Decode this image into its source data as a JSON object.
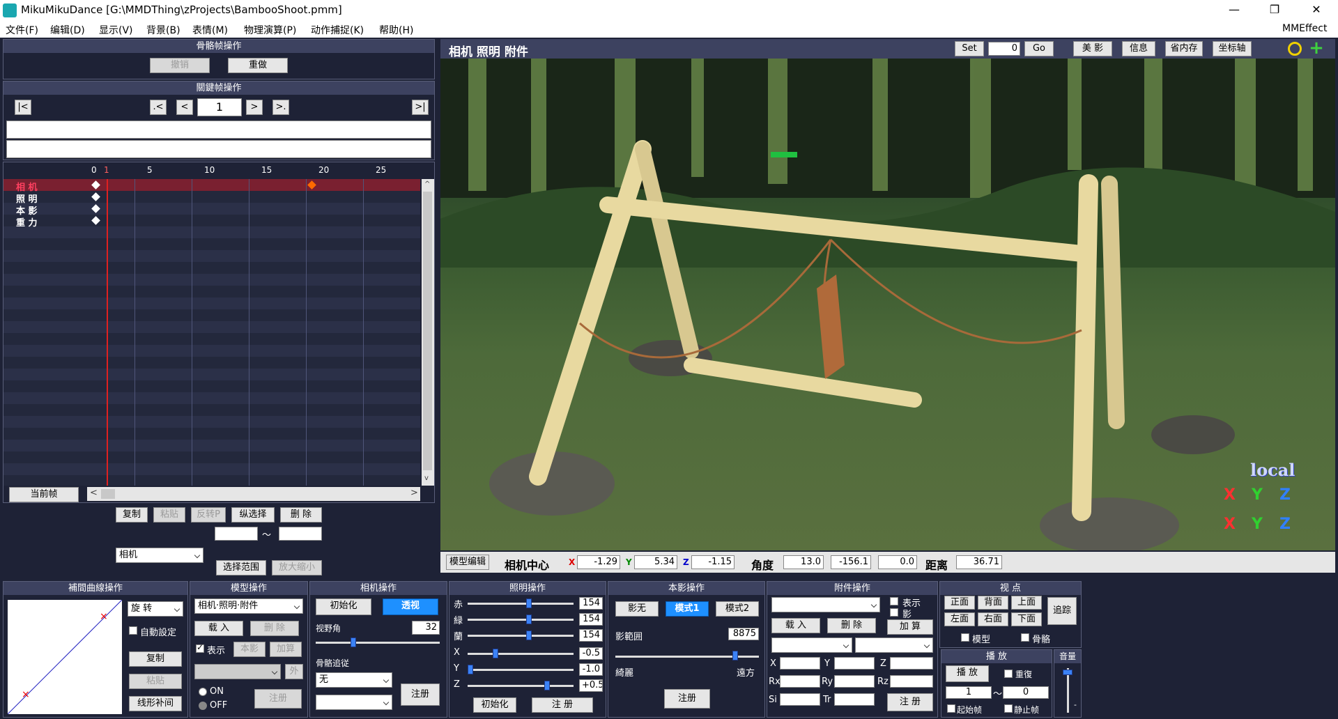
{
  "window": {
    "title": "MikuMikuDance [G:\\MMDThing\\zProjects\\BambooShoot.pmm]",
    "minimize": "—",
    "restore": "❐",
    "close": "✕"
  },
  "menu": {
    "items": [
      "文件(F)",
      "编辑(D)",
      "显示(V)",
      "背景(B)",
      "表情(M)",
      "物理演算(P)",
      "动作捕捉(K)",
      "帮助(H)"
    ],
    "right": "MMEffect"
  },
  "bone_frame": {
    "title": "骨骼帧操作",
    "undo": "撤销",
    "redo": "重做"
  },
  "keyframe": {
    "title": "關鍵帧操作",
    "first": "|<",
    "prev_key": ".<",
    "prev": "<",
    "frame": "1",
    "next": ">",
    "next_key": ">.",
    "last": ">|"
  },
  "timeline": {
    "ticks": [
      "0",
      "5",
      "10",
      "15",
      "20",
      "25"
    ],
    "tick_1": "1",
    "tracks": [
      "相 机",
      "照 明",
      "本 影",
      "重 力"
    ],
    "current_frame_btn": "当前帧",
    "scroll_left": "<",
    "scroll_right": ">",
    "scroll_up": "^",
    "scroll_down": "v"
  },
  "timeline_buttons": {
    "copy": "复制",
    "paste": "粘贴",
    "reverse": "反转P",
    "vertical_select": "纵选择",
    "delete": "删 除",
    "range_sep": "～",
    "target": "相机",
    "select_range": "选择范围",
    "scale": "放大缩小"
  },
  "viewport": {
    "title": "相机 照明 附件",
    "set": "Set",
    "frame_value": "0",
    "go": "Go",
    "beauty": "美 影",
    "info": "信息",
    "save_memory": "省内存",
    "axis": "坐标轴",
    "local": "local"
  },
  "camera_bar": {
    "model_edit": "模型编辑",
    "center_label": "相机中心",
    "x_label": "X",
    "x": "-1.29",
    "y_label": "Y",
    "y": "5.34",
    "z_label": "Z",
    "z": "-1.15",
    "angle_label": "角度",
    "ax": "13.0",
    "ay": "-156.1",
    "az": "0.0",
    "distance_label": "距离",
    "distance": "36.71"
  },
  "interp": {
    "title": "補間曲線操作",
    "type": "旋 转",
    "auto": "自動設定",
    "copy": "复制",
    "paste": "粘贴",
    "linear": "线形补间"
  },
  "model_op": {
    "title": "模型操作",
    "target": "相机·照明·附件",
    "load": "载 入",
    "delete": "删 除",
    "show": "表示",
    "shadow": "本影",
    "add": "加算",
    "outer": "外",
    "on": "ON",
    "off": "OFF",
    "register": "注册"
  },
  "camera_op": {
    "title": "相机操作",
    "init": "初始化",
    "perspective": "透视",
    "fov_label": "视野角",
    "fov": "32",
    "bone_follow": "骨骼追従",
    "follow_target": "无",
    "register": "注册"
  },
  "light_op": {
    "title": "照明操作",
    "r_label": "赤",
    "r": "154",
    "g_label": "緑",
    "g": "154",
    "b_label": "蘭",
    "b": "154",
    "x_label": "X",
    "x": "-0.5",
    "y_label": "Y",
    "y": "-1.0",
    "z_label": "Z",
    "z": "+0.5",
    "init": "初始化",
    "register": "注 册"
  },
  "shadow_op": {
    "title": "本影操作",
    "none": "影无",
    "mode1": "模式1",
    "mode2": "模式2",
    "range_label": "影範囲",
    "range": "8875",
    "near": "綺麗",
    "far": "遠方",
    "register": "注册"
  },
  "accessory_op": {
    "title": "附件操作",
    "show": "表示",
    "shadow": "影",
    "load": "载 入",
    "delete": "删 除",
    "add": "加 算",
    "x": "X",
    "y": "Y",
    "z": "Z",
    "rx": "Rx",
    "ry": "Ry",
    "rz": "Rz",
    "si": "Si",
    "tr": "Tr",
    "register": "注 册"
  },
  "view_op": {
    "title": "视 点",
    "front": "正面",
    "back": "背面",
    "top": "上面",
    "left": "左面",
    "right": "右面",
    "bottom": "下面",
    "track": "追踪",
    "model": "模型",
    "bone": "骨骼"
  },
  "play_op": {
    "title": "播 放",
    "play": "播 放",
    "repeat": "重復",
    "start": "1",
    "sep": "～",
    "end": "0",
    "start_frame": "起始帧",
    "stop_frame": "静止帧"
  },
  "volume": {
    "title": "音量",
    "minus": "-"
  },
  "colors": {
    "bg": "#1e2236",
    "header": "#3d4260",
    "accent": "#1e90ff",
    "keyframe": "#ff6a00",
    "playhead": "#e02020"
  }
}
